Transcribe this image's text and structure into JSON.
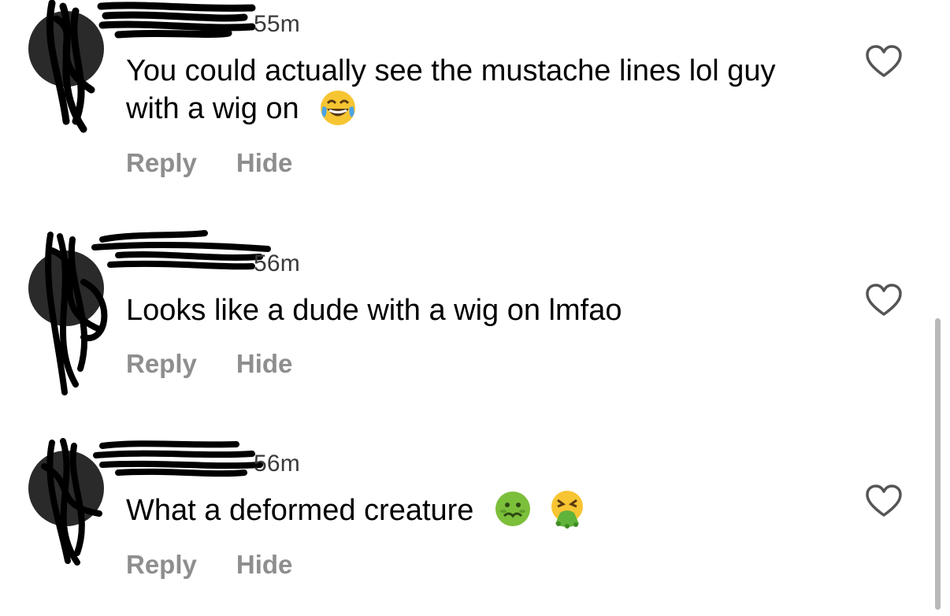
{
  "comments": [
    {
      "timestamp": "55m",
      "text": "You could actually see the mustache lines lol guy with a wig on",
      "emojis": [
        "face-with-tears-of-joy"
      ],
      "reply_label": "Reply",
      "hide_label": "Hide"
    },
    {
      "timestamp": "56m",
      "text": "Looks like a dude with a wig on lmfao",
      "emojis": [],
      "reply_label": "Reply",
      "hide_label": "Hide"
    },
    {
      "timestamp": "56m",
      "text": "What a deformed creature",
      "emojis": [
        "nauseated-face",
        "face-vomiting"
      ],
      "reply_label": "Reply",
      "hide_label": "Hide"
    }
  ],
  "colors": {
    "text": "#000000",
    "secondary": "#8e8e8e",
    "timestamp": "#3a3a3a",
    "redaction": "#000000",
    "heart_outline": "#555555",
    "scrollbar": "#b8b8b8"
  },
  "icons": {
    "like": "heart-outline-icon"
  }
}
